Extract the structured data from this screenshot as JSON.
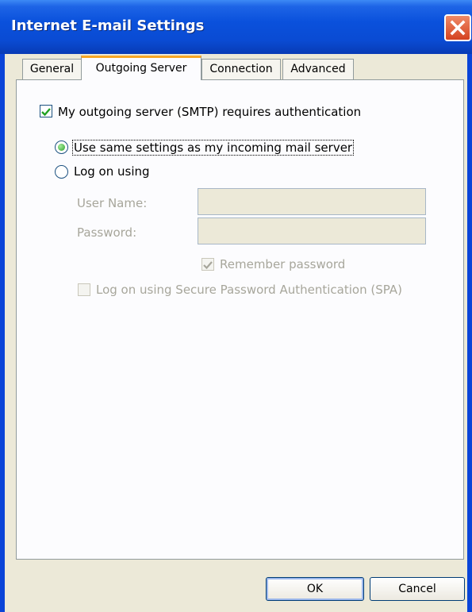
{
  "window": {
    "title": "Internet E-mail Settings"
  },
  "tabs": [
    {
      "label": "General",
      "active": false
    },
    {
      "label": "Outgoing Server",
      "active": true
    },
    {
      "label": "Connection",
      "active": false
    },
    {
      "label": "Advanced",
      "active": false
    }
  ],
  "outgoing": {
    "requires_auth": {
      "label": "My outgoing server (SMTP) requires authentication",
      "checked": true
    },
    "use_same": {
      "label": "Use same settings as my incoming mail server",
      "selected": true
    },
    "log_on_using": {
      "label": "Log on using",
      "selected": false
    },
    "username": {
      "label": "User Name:",
      "value": ""
    },
    "password": {
      "label": "Password:",
      "value": ""
    },
    "remember_password": {
      "label": "Remember password",
      "checked": true,
      "enabled": false
    },
    "spa": {
      "label": "Log on using Secure Password Authentication (SPA)",
      "checked": false,
      "enabled": false
    }
  },
  "buttons": {
    "ok": "OK",
    "cancel": "Cancel"
  },
  "colors": {
    "titlebar": "#0a51dc",
    "active_tab_accent": "#f7a624",
    "dialog_bg": "#ece9d8"
  }
}
